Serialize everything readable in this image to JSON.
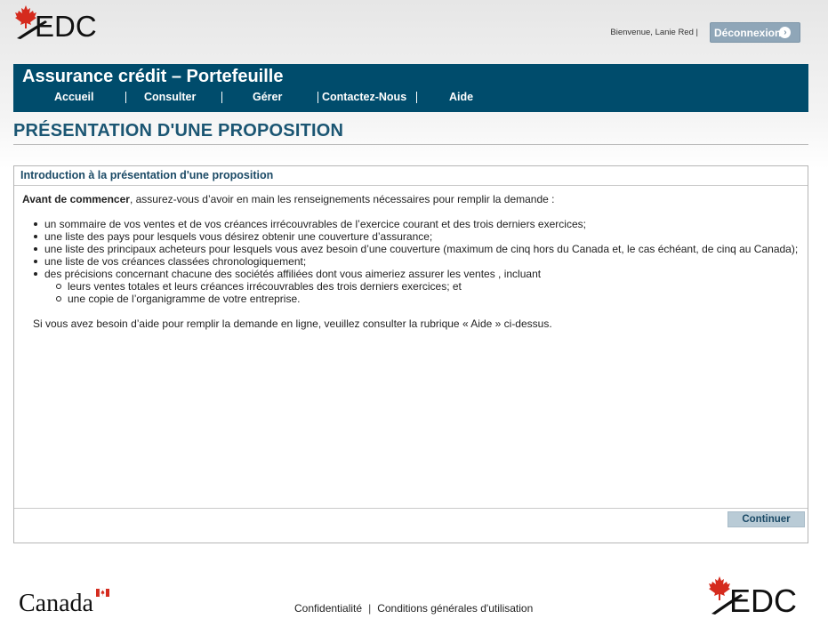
{
  "header": {
    "logo_text": "EDC",
    "welcome": "Bienvenue, Lanie Red |",
    "logout_label": "Déconnexion"
  },
  "banner": {
    "title": "Assurance crédit – Portefeuille",
    "nav": [
      {
        "label": "Accueil"
      },
      {
        "label": "Consulter"
      },
      {
        "label": "Gérer"
      },
      {
        "label": "Contactez-Nous"
      },
      {
        "label": "Aide"
      }
    ]
  },
  "page": {
    "title": "PRÉSENTATION D'UNE PROPOSITION"
  },
  "panel": {
    "header": "Introduction à la présentation d'une proposition",
    "intro_bold": "Avant de commencer",
    "intro_rest": ", assurez-vous d’avoir en main les renseignements nécessaires pour remplir la demande :",
    "items": [
      "un sommaire de vos ventes et de vos créances irrécouvrables de l’exercice courant et des trois derniers exercices;",
      "une liste des pays pour lesquels vous désirez obtenir une couverture d’assurance;",
      "une liste des principaux acheteurs pour lesquels vous avez besoin d’une couverture (maximum de cinq hors du Canada et, le cas échéant, de cinq au Canada);",
      "une liste de vos créances classées chronologiquement;",
      "des précisions concernant chacune des sociétés affiliées dont vous aimeriez assurer les ventes , incluant"
    ],
    "sub_items": [
      "leurs ventes totales et leurs créances irrécouvrables des trois derniers exercices; et",
      "une copie de l’organigramme de votre entreprise."
    ],
    "help": "Si vous avez besoin d’aide pour remplir la demande en ligne, veuillez consulter la rubrique « Aide » ci-dessus.",
    "continue_label": "Continuer"
  },
  "footer": {
    "canada_wordmark": "Canada",
    "privacy": "Confidentialité",
    "separator": "|",
    "terms": "Conditions générales d'utilisation",
    "logo_text": "EDC"
  },
  "colors": {
    "banner": "#004c6c",
    "title": "#1b5673",
    "button": "#8fa6b8",
    "continue_button": "#b9cbd6",
    "maple_red": "#d52b1e"
  }
}
